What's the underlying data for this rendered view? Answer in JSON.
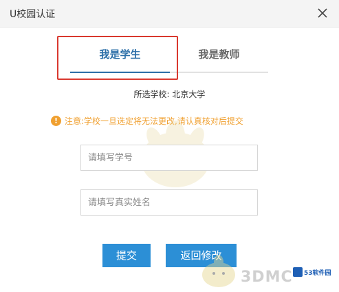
{
  "window": {
    "title": "U校园认证",
    "close_icon": "close-icon"
  },
  "tabs": [
    {
      "label": "我是学生",
      "active": true
    },
    {
      "label": "我是教师",
      "active": false
    }
  ],
  "school": {
    "label": "所选学校:",
    "value": "北京大学"
  },
  "notice": {
    "icon": "!",
    "text": "注意:学校一旦选定将无法更改,请认真核对后提交"
  },
  "fields": {
    "student_id_placeholder": "请填写学号",
    "real_name_placeholder": "请填写真实姓名"
  },
  "buttons": {
    "submit": "提交",
    "modify": "返回修改"
  },
  "watermarks": {
    "brand": "3DMC",
    "site": "53软件园"
  },
  "colors": {
    "accent": "#2c6fa8",
    "button": "#2c8fd6",
    "warning": "#f0a030",
    "highlight": "#d9382e"
  }
}
